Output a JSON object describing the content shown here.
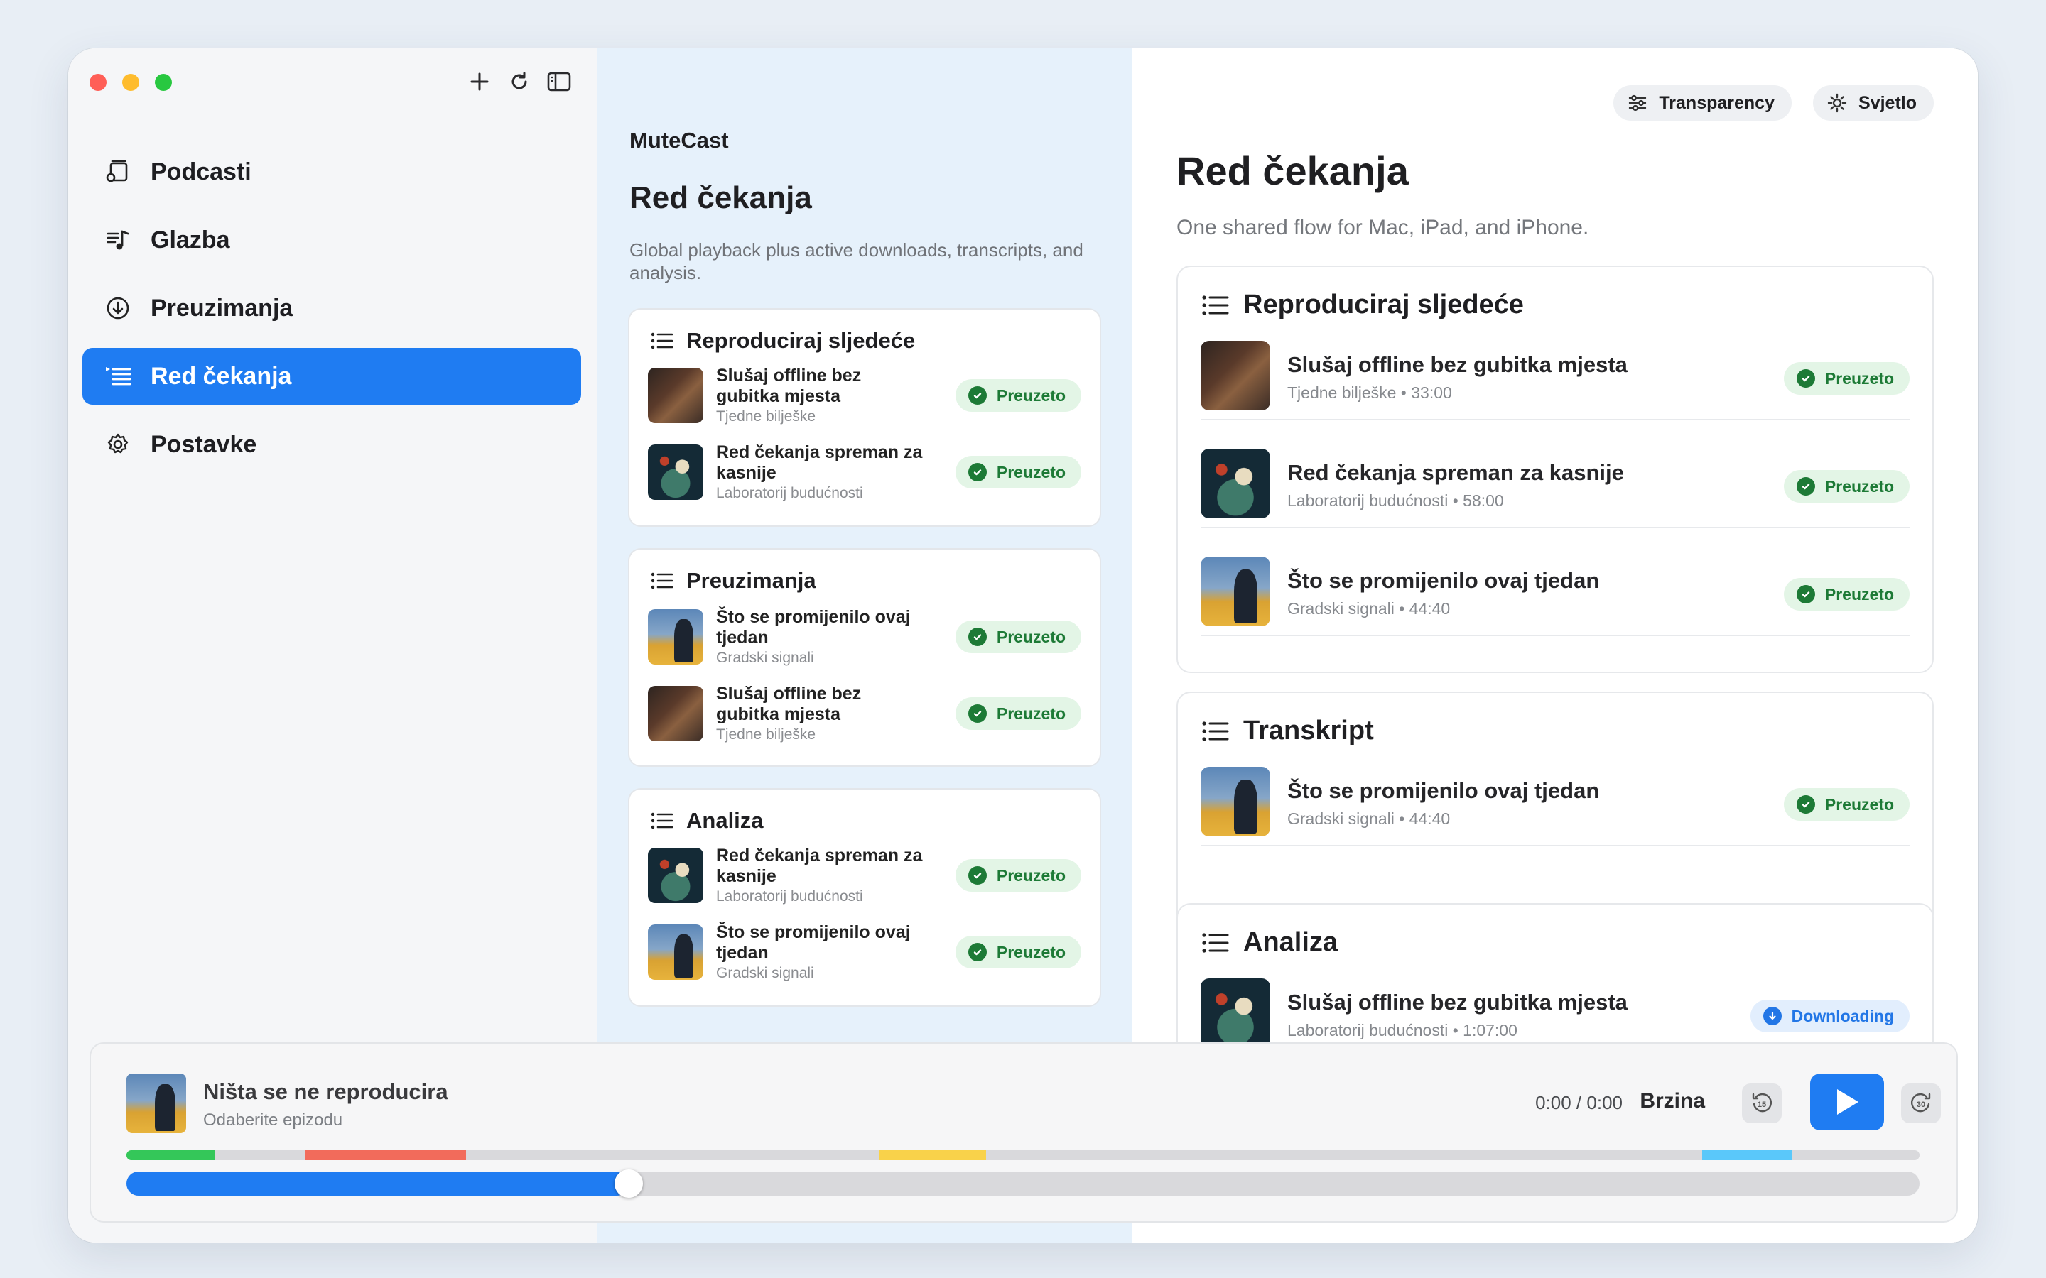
{
  "sidebar": {
    "items": [
      {
        "label": "Podcasti",
        "icon": "podcasts-icon"
      },
      {
        "label": "Glazba",
        "icon": "music-icon"
      },
      {
        "label": "Preuzimanja",
        "icon": "download-icon"
      },
      {
        "label": "Red čekanja",
        "icon": "queue-icon",
        "active": true
      },
      {
        "label": "Postavke",
        "icon": "settings-icon"
      }
    ]
  },
  "middle": {
    "app_name": "MuteCast",
    "title": "Red čekanja",
    "subtitle": "Global playback plus active downloads, transcripts, and analysis.",
    "sections": [
      {
        "title": "Reproduciraj sljedeće",
        "rows": [
          {
            "title": "Slušaj offline bez gubitka mjesta",
            "subtitle": "Tjedne bilješke",
            "status": "Preuzeto"
          },
          {
            "title": "Red čekanja spreman za kasnije",
            "subtitle": "Laboratorij budućnosti",
            "status": "Preuzeto"
          }
        ]
      },
      {
        "title": "Preuzimanja",
        "rows": [
          {
            "title": "Što se promijenilo ovaj tjedan",
            "subtitle": "Gradski signali",
            "status": "Preuzeto"
          },
          {
            "title": "Slušaj offline bez gubitka mjesta",
            "subtitle": "Tjedne bilješke",
            "status": "Preuzeto"
          }
        ]
      },
      {
        "title": "Analiza",
        "rows": [
          {
            "title": "Red čekanja spreman za kasnije",
            "subtitle": "Laboratorij budućnosti",
            "status": "Preuzeto"
          },
          {
            "title": "Što se promijenilo ovaj tjedan",
            "subtitle": "Gradski signali",
            "status": "Preuzeto"
          }
        ]
      }
    ]
  },
  "right": {
    "buttons": {
      "transparency": "Transparency",
      "theme": "Svjetlo"
    },
    "title": "Red čekanja",
    "subtitle": "One shared flow for Mac, iPad, and iPhone.",
    "sections": [
      {
        "title": "Reproduciraj sljedeće",
        "rows": [
          {
            "title": "Slušaj offline bez gubitka mjesta",
            "subtitle": "Tjedne bilješke • 33:00",
            "status": "Preuzeto"
          },
          {
            "title": "Red čekanja spreman za kasnije",
            "subtitle": "Laboratorij budućnosti • 58:00",
            "status": "Preuzeto"
          },
          {
            "title": "Što se promijenilo ovaj tjedan",
            "subtitle": "Gradski signali • 44:40",
            "status": "Preuzeto"
          }
        ]
      },
      {
        "title": "Transkript",
        "rows": [
          {
            "title": "Što se promijenilo ovaj tjedan",
            "subtitle": "Gradski signali • 44:40",
            "status": "Preuzeto"
          }
        ]
      },
      {
        "title": "Analiza",
        "rows": [
          {
            "title": "Slušaj offline bez gubitka mjesta",
            "subtitle": "Laboratorij budućnosti • 1:07:00",
            "status": "Downloading"
          }
        ]
      }
    ]
  },
  "player": {
    "title": "Ništa se ne reproducira",
    "subtitle": "Odaberite epizodu",
    "time": "0:00 / 0:00",
    "speed_label": "Brzina",
    "skip_back": "15",
    "skip_forward": "30",
    "progress_fraction": 0.28
  },
  "colors": {
    "accent": "#1f7cf2",
    "success": "#1d7a36",
    "success_bg": "#e3f5e6",
    "chapter_green": "#34c759",
    "chapter_red": "#f26b5b",
    "chapter_yellow": "#f9d24a",
    "chapter_cyan": "#5ac8fa"
  }
}
